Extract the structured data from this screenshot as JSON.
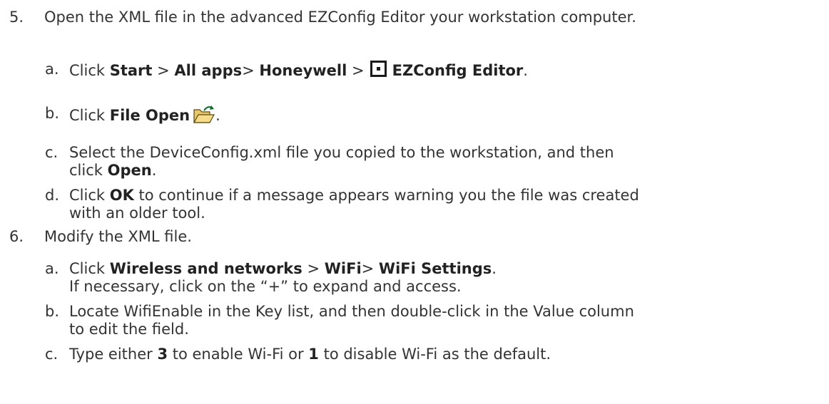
{
  "step5": {
    "number": "5.",
    "text": "Open the XML file in the advanced EZConfig Editor your workstation computer.",
    "subs": {
      "a": {
        "letter": "a.",
        "click": "Click ",
        "start": "Start",
        "sep1": " > ",
        "all_apps": "All apps",
        "sep2": "> ",
        "honeywell": "Honeywell",
        "sep3": " >",
        "ezconfig": "EZConfig Editor",
        "end": ".",
        "icon": "ezconfig-editor-icon"
      },
      "b": {
        "letter": "b.",
        "click": "Click ",
        "file_open": "File Open",
        "end": ".",
        "icon": "folder-open-icon"
      },
      "c": {
        "letter": "c.",
        "line1": "Select the DeviceConfig.xml file you copied to the workstation, and then",
        "line2_pre": "click ",
        "open": "Open",
        "end": "."
      },
      "d": {
        "letter": "d.",
        "click": "Click ",
        "ok": "OK",
        "line1_rest": " to continue if a message appears warning you the file was created",
        "line2": "with an older tool."
      }
    }
  },
  "step6": {
    "number": "6.",
    "text": "Modify the XML file.",
    "subs": {
      "a": {
        "letter": "a.",
        "click": "Click ",
        "wireless": "Wireless and networks",
        "sep1": " > ",
        "wifi": "WiFi",
        "sep2": "> ",
        "wifi_settings": "WiFi Settings",
        "end": ".",
        "line2": "If necessary, click on the “+” to expand and access."
      },
      "b": {
        "letter": "b.",
        "line1": "Locate WifiEnable in the Key list, and then double-click in the Value column",
        "line2": "to edit the field."
      },
      "c": {
        "letter": "c.",
        "pre": "Type either ",
        "three": "3",
        "mid1": " to enable Wi-Fi or ",
        "one": "1",
        "mid2": " to disable Wi-Fi as the default."
      }
    }
  }
}
